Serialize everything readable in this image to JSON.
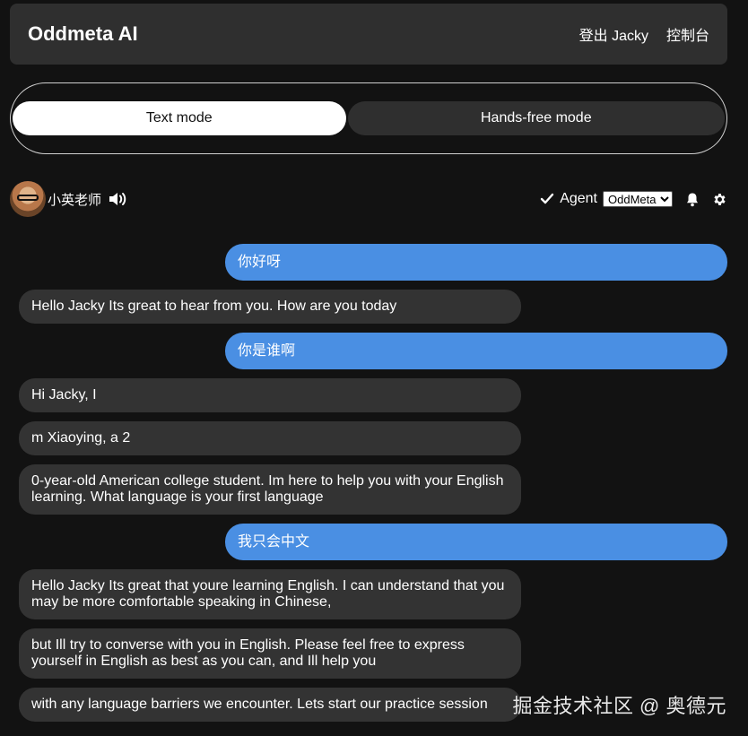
{
  "header": {
    "app_title": "Oddmeta AI",
    "logout_label": "登出 Jacky",
    "console_label": "控制台"
  },
  "modes": {
    "text_mode": "Text mode",
    "handsfree_mode": "Hands-free mode",
    "active": "text_mode"
  },
  "agent_bar": {
    "agent_name": "小英老师",
    "agent_label": "Agent",
    "selected_agent": "OddMeta",
    "icons": [
      "avatar",
      "speaker-icon",
      "check-icon",
      "bell-icon",
      "gear-icon"
    ]
  },
  "messages": [
    {
      "role": "user",
      "text": "你好呀"
    },
    {
      "role": "bot",
      "text": "Hello Jacky Its great to hear from you. How are you today"
    },
    {
      "role": "user",
      "text": "你是谁啊"
    },
    {
      "role": "bot",
      "text": "Hi Jacky, I"
    },
    {
      "role": "bot",
      "text": "m Xiaoying, a 2"
    },
    {
      "role": "bot",
      "text": "0-year-old American college student. Im here to help you with your English learning. What language is your first language"
    },
    {
      "role": "user",
      "text": "我只会中文"
    },
    {
      "role": "bot",
      "text": "Hello Jacky Its great that youre learning English. I can understand that you may be more comfortable speaking in Chinese,"
    },
    {
      "role": "bot",
      "text": "but Ill try to converse with you in English. Please feel free to express yourself in English as best as you can, and Ill help you"
    },
    {
      "role": "bot",
      "text": "with any language barriers we encounter. Lets start our practice session"
    }
  ],
  "watermark": "掘金技术社区 @ 奥德元",
  "colors": {
    "background": "#121212",
    "header": "#2f2f2f",
    "user_bubble": "#4a8fe3",
    "bot_bubble": "#333333"
  }
}
